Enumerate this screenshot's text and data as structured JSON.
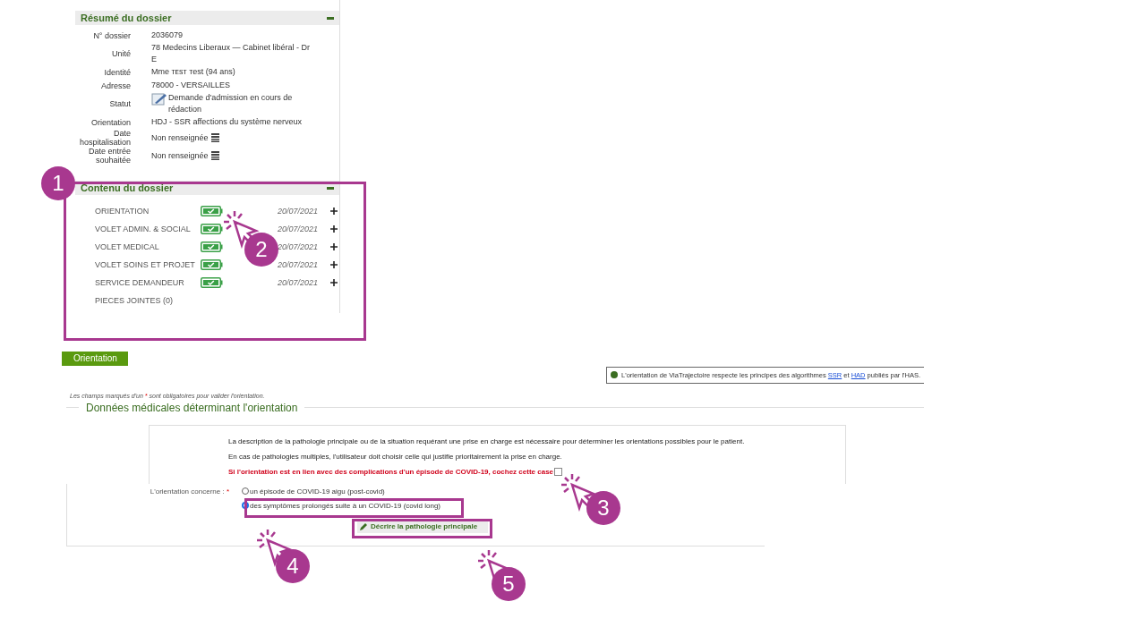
{
  "summary": {
    "title": "Résumé du dossier",
    "rows": [
      {
        "label": "N° dossier",
        "value": "2036079"
      },
      {
        "label": "Unité",
        "value": "78 Medecins Liberaux — Cabinet libéral - Dr E"
      },
      {
        "label": "Identité",
        "value": "Mme ᴛᴇsᴛ ᴛest (94 ans)"
      },
      {
        "label": "Adresse",
        "value": "78000 - VERSAILLES"
      },
      {
        "label": "Statut",
        "value": "Demande d'admission en cours de rédaction",
        "kind": "status"
      },
      {
        "label": "Orientation",
        "value": "HDJ - SSR affections du système nerveux"
      },
      {
        "label": "Date hospitalisation",
        "value": "Non renseignée",
        "kind": "date"
      },
      {
        "label": "Date entrée souhaitée",
        "value": "Non renseignée",
        "kind": "date"
      }
    ]
  },
  "contents": {
    "title": "Contenu du dossier",
    "items": [
      {
        "label": "ORIENTATION",
        "done": true,
        "date": "20/07/2021",
        "expandable": true
      },
      {
        "label": "VOLET ADMIN. & SOCIAL",
        "done": true,
        "date": "20/07/2021",
        "expandable": true
      },
      {
        "label": "VOLET MEDICAL",
        "done": true,
        "date": "20/07/2021",
        "expandable": true
      },
      {
        "label": "VOLET SOINS ET PROJET",
        "done": true,
        "date": "20/07/2021",
        "expandable": true
      },
      {
        "label": "SERVICE DEMANDEUR",
        "done": true,
        "date": "20/07/2021",
        "expandable": true
      },
      {
        "label": "PIECES JOINTES (0)",
        "done": false,
        "expandable": false
      }
    ]
  },
  "tab": {
    "label": "Orientation"
  },
  "info": {
    "parts": [
      {
        "kind": "text",
        "text": "L'orientation de ViaTrajectoire respecte les principes des algorithmes "
      },
      {
        "kind": "link",
        "text": "SSR"
      },
      {
        "kind": "text",
        "text": " et "
      },
      {
        "kind": "link",
        "text": "HAD"
      },
      {
        "kind": "text",
        "text": " publiés par l'HAS."
      }
    ]
  },
  "required_note": {
    "before": "Les champs marqués d'un ",
    "mark": "*",
    "after": " sont obligatoires pour valider l'orientation."
  },
  "section": {
    "title": "Données médicales déterminant l'orientation",
    "paragraphs": [
      "La description de la pathologie principale ou de la situation requérant une prise en charge est nécessaire pour déterminer les orientations possibles pour le patient.",
      "En cas de pathologies multiples, l'utilisateur doit choisir celle qui justifie prioritairement la prise en charge."
    ],
    "covid_checkbox": {
      "label": "Si l'orientation est en lien avec des complications d'un épisode de COVID-19, cochez cette case",
      "checked": false
    },
    "question": {
      "label": "L'orientation concerne :",
      "mark": "*",
      "options": [
        {
          "label": "un épisode de COVID-19 aigu (post-covid)",
          "selected": false
        },
        {
          "label": "des symptômes prolongés suite à un COVID-19 (covid long)",
          "selected": true
        }
      ]
    },
    "button": {
      "label": "Décrire la pathologie principale"
    }
  },
  "callouts": [
    {
      "number": "1"
    },
    {
      "number": "2"
    },
    {
      "number": "3"
    },
    {
      "number": "4"
    },
    {
      "number": "5"
    }
  ]
}
